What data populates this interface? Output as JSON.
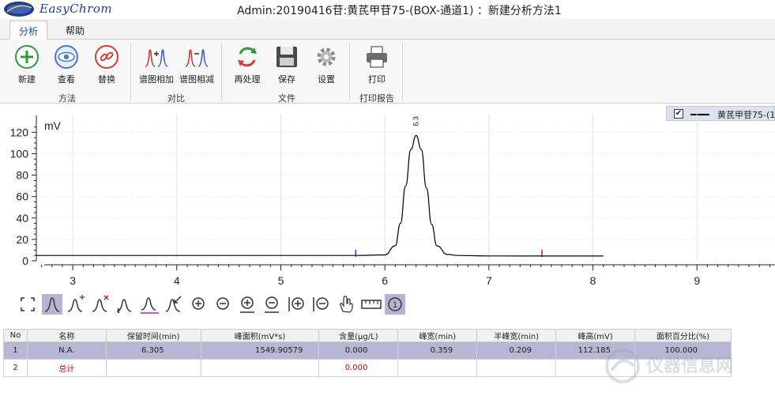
{
  "app": {
    "brand": "EasyChrom",
    "window_title": "Admin:20190416苷:黄芪甲苷75-(BOX-通道1) ：新建分析方法1"
  },
  "tabs": [
    {
      "label": "分析",
      "active": true
    },
    {
      "label": "帮助",
      "active": false
    }
  ],
  "ribbon": {
    "groups": [
      {
        "label": "方法",
        "buttons": [
          "新建",
          "查看",
          "替换"
        ]
      },
      {
        "label": "对比",
        "buttons": [
          "谱图相加",
          "谱图相减"
        ]
      },
      {
        "label": "文件",
        "buttons": [
          "再处理",
          "保存",
          "设置"
        ]
      },
      {
        "label": "打印报告",
        "buttons": [
          "打印"
        ]
      }
    ]
  },
  "legend": {
    "checked": true,
    "series_label": "黄芪甲苷75-(1"
  },
  "chart_data": {
    "type": "line",
    "ylabel": "mV",
    "xlim": [
      2.65,
      9.75
    ],
    "ylim": [
      0,
      125
    ],
    "xticks": [
      3,
      4,
      5,
      6,
      7,
      8,
      9
    ],
    "yticks": [
      0,
      20,
      40,
      60,
      80,
      100,
      120
    ],
    "peak_label": "6.3",
    "series": [
      {
        "x": [
          2.65,
          5.72,
          6.0,
          6.1,
          6.15,
          6.2,
          6.25,
          6.3,
          6.35,
          6.4,
          6.45,
          6.5,
          6.6,
          6.7,
          7.0,
          7.5,
          8.1
        ],
        "y": [
          5,
          5,
          5.5,
          14,
          35,
          70,
          104,
          117,
          104,
          68,
          34,
          14,
          6,
          5,
          4.6,
          4.5,
          4.5
        ]
      }
    ],
    "markers": [
      {
        "x": 5.72,
        "color": "#3a3aa8"
      },
      {
        "x": 7.51,
        "color": "#cc2222"
      }
    ]
  },
  "colors": {
    "accent": "#1a4fa0",
    "selected_row": "#b9b5d4",
    "total_text": "#cc0000"
  },
  "toolbar": [
    "full-view-icon",
    "peak-icon",
    "add-peak-icon",
    "delete-peak-icon",
    "baseline-icon",
    "integrate-icon",
    "split-peak-icon",
    "zoom-in-icon",
    "zoom-out-icon",
    "zoom-in-x-icon",
    "zoom-out-y-icon",
    "zoom-in-range-icon",
    "zoom-out-range-icon",
    "pan-icon",
    "ruler-icon",
    "info-icon"
  ],
  "table": {
    "headers": [
      "No",
      "名称",
      "保留时间(min)",
      "峰面积(mV*s)",
      "含量(μg/L)",
      "峰宽(min)",
      "半峰宽(min)",
      "峰高(mV)",
      "面积百分比(%)"
    ],
    "rows": [
      {
        "cells": [
          "1",
          "N.A.",
          "6.305",
          "1549.90579",
          "0.000",
          "0.359",
          "0.209",
          "112.185",
          "100.000"
        ]
      },
      {
        "cells": [
          "2",
          "总计",
          "",
          "",
          "0.000",
          "",
          "",
          "",
          ""
        ]
      }
    ]
  },
  "watermark": {
    "text": "仪器信息网"
  }
}
